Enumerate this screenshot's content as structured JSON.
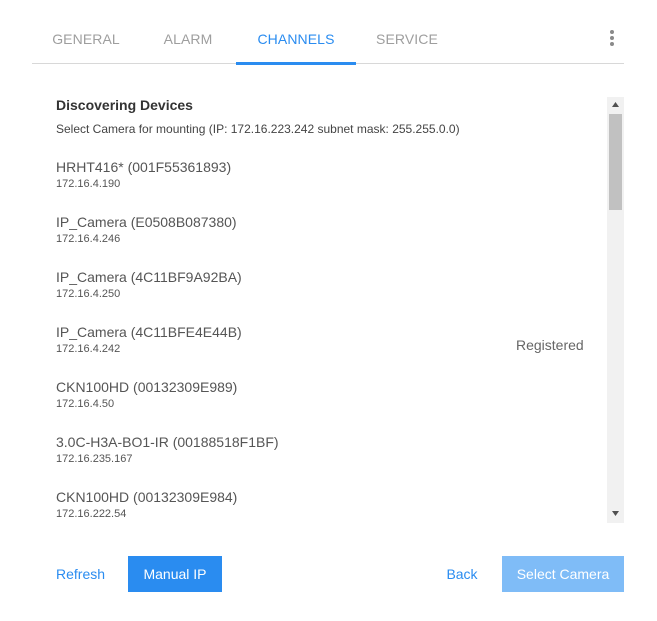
{
  "tabs": [
    {
      "label": "GENERAL",
      "active": false
    },
    {
      "label": "ALARM",
      "active": false
    },
    {
      "label": "CHANNELS",
      "active": true
    },
    {
      "label": "SERVICE",
      "active": false
    }
  ],
  "menu_icon": "more-vertical-icon",
  "colors": {
    "accent": "#2a8cf0",
    "disabled_button": "#7fbcf7",
    "inactive_tab": "#9e9e9e"
  },
  "main": {
    "heading": "Discovering Devices",
    "subtitle": "Select Camera for mounting (IP: 172.16.223.242 subnet mask: 255.255.0.0)"
  },
  "devices": [
    {
      "name": "HRHT416* (001F55361893)",
      "ip": "172.16.4.190",
      "status": ""
    },
    {
      "name": "IP_Camera (E0508B087380)",
      "ip": "172.16.4.246",
      "status": ""
    },
    {
      "name": "IP_Camera (4C11BF9A92BA)",
      "ip": "172.16.4.250",
      "status": ""
    },
    {
      "name": "IP_Camera (4C11BFE4E44B)",
      "ip": "172.16.4.242",
      "status": "Registered"
    },
    {
      "name": "CKN100HD (00132309E989)",
      "ip": "172.16.4.50",
      "status": ""
    },
    {
      "name": "3.0C-H3A-BO1-IR (00188518F1BF)",
      "ip": "172.16.235.167",
      "status": ""
    },
    {
      "name": "CKN100HD (00132309E984)",
      "ip": "172.16.222.54",
      "status": ""
    }
  ],
  "footer": {
    "refresh": "Refresh",
    "manual_ip": "Manual IP",
    "back": "Back",
    "select_camera": "Select Camera"
  }
}
